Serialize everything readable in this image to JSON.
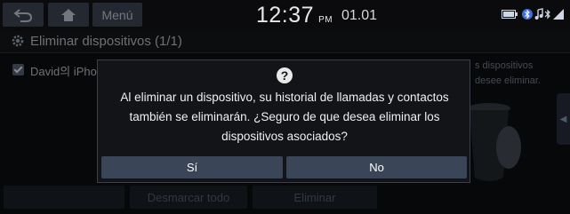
{
  "statusbar": {
    "menu_label": "Menú",
    "clock_time": "12:37",
    "clock_ampm": "PM",
    "date": "01.01",
    "icons": [
      "back-icon",
      "home-icon",
      "battery-icon",
      "bluetooth-icon",
      "music-note-icon",
      "bluetooth-phone-icon",
      "signal-icon"
    ]
  },
  "screen": {
    "title": "Eliminar dispositivos (1/1)",
    "device_row": "David의 iPho",
    "hint_line1": "s dispositivos",
    "hint_line2": "desee eliminar.",
    "bottom_buttons": [
      "",
      "Desmarcar todo",
      "Eliminar"
    ]
  },
  "dialog": {
    "icon": "question-icon",
    "message": "Al eliminar un dispositivo, su historial de llamadas y contactos también se eliminarán. ¿Seguro de que desea eliminar los dispositivos asociados?",
    "yes_label": "Sí",
    "no_label": "No"
  },
  "colors": {
    "dialog_bg": "#121418",
    "button_bg": "#3b4558",
    "text": "#ffffff"
  }
}
